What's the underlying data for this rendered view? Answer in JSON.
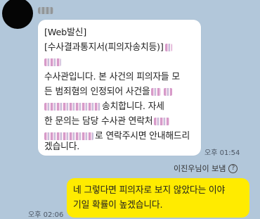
{
  "incoming": {
    "lines": [
      "[Web발신]",
      "[수사결과통지서(피의자송치등)]",
      "수사관입니다. 본 사건의 피의자들 모",
      "든 범죄혐의 인정되어 사건을",
      "송치합니다. 자세",
      "한 문의는 담당 수사관 연락처",
      "로 연락주시면 안내해드리",
      "겠습니다."
    ],
    "time": "오후 01:54"
  },
  "read_notice": "이진우님이 보냄",
  "outgoing": {
    "lines": [
      "네 그렇다면 피의자로 보지 않았다는 이야",
      "기일 확률이 높겠습니다."
    ],
    "time": "오후 02:06"
  }
}
